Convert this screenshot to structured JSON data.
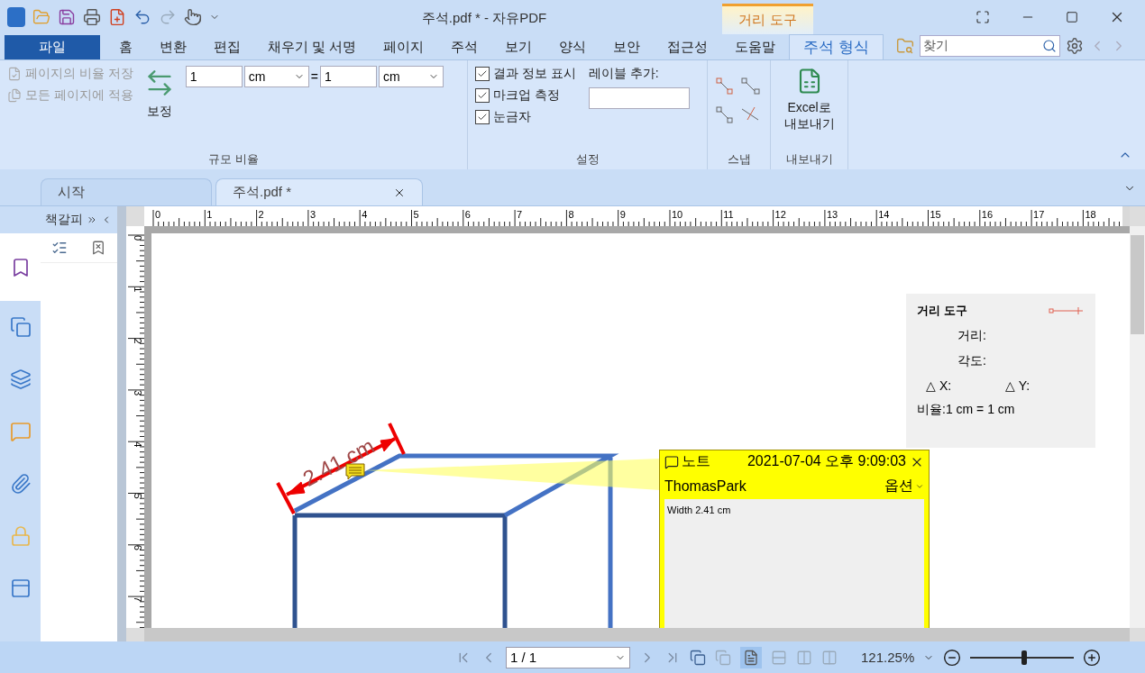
{
  "window": {
    "title": "주석.pdf * - 자유PDF",
    "context_tab": "거리 도구"
  },
  "menu_tabs": [
    {
      "label": "파일",
      "kind": "file",
      "selected": false
    },
    {
      "label": "홈",
      "kind": "tab",
      "selected": false
    },
    {
      "label": "변환",
      "kind": "tab",
      "selected": false
    },
    {
      "label": "편집",
      "kind": "tab",
      "selected": false
    },
    {
      "label": "채우기 및 서명",
      "kind": "tab",
      "selected": false
    },
    {
      "label": "페이지",
      "kind": "tab",
      "selected": false
    },
    {
      "label": "주석",
      "kind": "tab",
      "selected": false
    },
    {
      "label": "보기",
      "kind": "tab",
      "selected": false
    },
    {
      "label": "양식",
      "kind": "tab",
      "selected": false
    },
    {
      "label": "보안",
      "kind": "tab",
      "selected": false
    },
    {
      "label": "접근성",
      "kind": "tab",
      "selected": false
    },
    {
      "label": "도움말",
      "kind": "tab",
      "selected": false
    },
    {
      "label": "주석 형식",
      "kind": "tab",
      "selected": true
    }
  ],
  "search": {
    "placeholder": "찾기"
  },
  "ribbon": {
    "scale": {
      "save_ratio": "페이지의 비율 저장",
      "apply_all": "모든 페이지에 적용",
      "calibrate": "보정",
      "from_value": "1",
      "from_unit": "cm",
      "equals": "=",
      "to_value": "1",
      "to_unit": "cm",
      "label": "규모 비율"
    },
    "settings": {
      "options": [
        {
          "label": "결과 정보 표시",
          "checked": true
        },
        {
          "label": "마크업 측정",
          "checked": true
        },
        {
          "label": "눈금자",
          "checked": true
        }
      ],
      "label_prompt": "레이블 추가:",
      "label": "설정"
    },
    "snap": {
      "label": "스냅"
    },
    "export": {
      "button": "Excel로 내보내기",
      "label": "내보내기"
    }
  },
  "doc_tabs": [
    {
      "label": "시작",
      "selected": false
    },
    {
      "label": "주석.pdf *",
      "selected": true
    }
  ],
  "side_panel": {
    "title": "책갈피"
  },
  "sidebar_icons": [
    {
      "kind": "bookmarks",
      "selected": true
    },
    {
      "kind": "pages",
      "selected": false
    },
    {
      "kind": "layers",
      "selected": false
    },
    {
      "kind": "comments",
      "selected": false
    },
    {
      "kind": "attachments",
      "selected": false
    },
    {
      "kind": "security",
      "selected": false
    },
    {
      "kind": "fields",
      "selected": false
    }
  ],
  "rulers": {
    "horizontal": [
      "0",
      "1",
      "2",
      "3",
      "4",
      "5",
      "6",
      "7",
      "8",
      "9",
      "10",
      "11",
      "12",
      "13",
      "14",
      "15",
      "16",
      "17",
      "18"
    ],
    "vertical": [
      "0",
      "1",
      "2",
      "3",
      "4",
      "5",
      "6",
      "7"
    ]
  },
  "drawing": {
    "measurement": "2.41 cm"
  },
  "distance_panel": {
    "title": "거리 도구",
    "distance": "거리:",
    "angle": "각도:",
    "dx": "△ X:",
    "dy": "△ Y:",
    "ratio": "비율:1 cm = 1 cm"
  },
  "note": {
    "type": "노트",
    "date": "2021-07-04 오후 9:09:03",
    "author": "ThomasPark",
    "options": "옵션",
    "text": "Width 2.41 cm"
  },
  "status_bar": {
    "page": "1 / 1",
    "zoom": "121.25%",
    "level": 0.52
  }
}
